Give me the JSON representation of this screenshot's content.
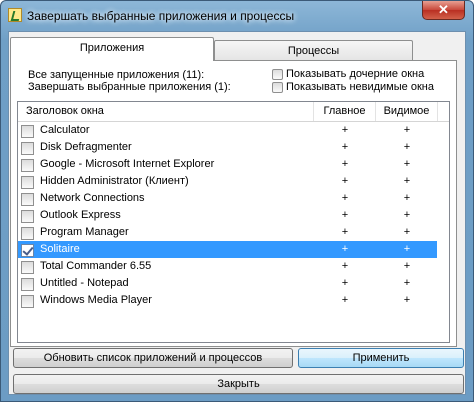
{
  "window": {
    "title": "Завершать выбранные приложения и процессы",
    "close_label": "✕"
  },
  "tabs": [
    {
      "label": "Приложения",
      "active": true
    },
    {
      "label": "Процессы",
      "active": false
    }
  ],
  "info": {
    "all_running": "Все запущенные приложения (11):",
    "terminate_selected": "Завершать выбранные приложения (1):"
  },
  "options": {
    "show_child_windows": {
      "label": "Показывать дочерние окна",
      "checked": false
    },
    "show_invisible_windows": {
      "label": "Показывать невидимые окна",
      "checked": false
    }
  },
  "table": {
    "columns": [
      "Заголовок окна",
      "Главное",
      "Видимое"
    ],
    "rows": [
      {
        "title": "Calculator",
        "main": "+",
        "visible": "+",
        "checked": false,
        "selected": false
      },
      {
        "title": "Disk Defragmenter",
        "main": "+",
        "visible": "+",
        "checked": false,
        "selected": false
      },
      {
        "title": "Google - Microsoft Internet Explorer",
        "main": "+",
        "visible": "+",
        "checked": false,
        "selected": false
      },
      {
        "title": "Hidden Administrator (Клиент)",
        "main": "+",
        "visible": "+",
        "checked": false,
        "selected": false
      },
      {
        "title": "Network Connections",
        "main": "+",
        "visible": "+",
        "checked": false,
        "selected": false
      },
      {
        "title": "Outlook Express",
        "main": "+",
        "visible": "+",
        "checked": false,
        "selected": false
      },
      {
        "title": "Program Manager",
        "main": "+",
        "visible": "+",
        "checked": false,
        "selected": false
      },
      {
        "title": "Solitaire",
        "main": "+",
        "visible": "+",
        "checked": true,
        "selected": true
      },
      {
        "title": "Total Commander 6.55",
        "main": "+",
        "visible": "+",
        "checked": false,
        "selected": false
      },
      {
        "title": "Untitled - Notepad",
        "main": "+",
        "visible": "+",
        "checked": false,
        "selected": false
      },
      {
        "title": "Windows Media Player",
        "main": "+",
        "visible": "+",
        "checked": false,
        "selected": false
      }
    ]
  },
  "buttons": {
    "refresh": "Обновить список приложений и процессов",
    "apply": "Применить",
    "close": "Закрыть"
  }
}
